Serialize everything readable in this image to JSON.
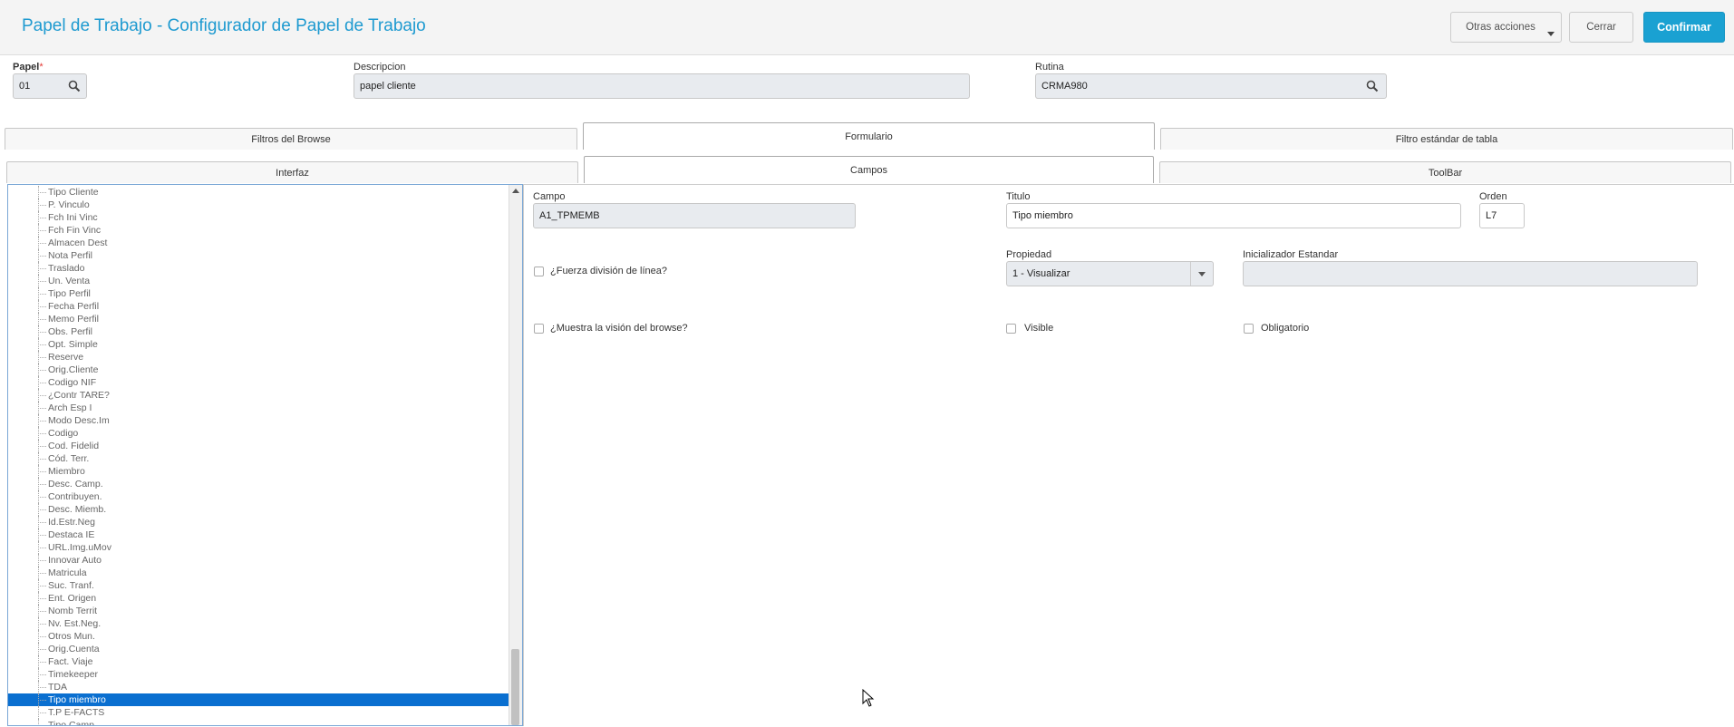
{
  "header": {
    "title": "Papel de Trabajo - Configurador de Papel de Trabajo",
    "buttons": {
      "other_actions": "Otras acciones",
      "close": "Cerrar",
      "confirm": "Confirmar"
    }
  },
  "form": {
    "papel": {
      "label": "Papel",
      "required_mark": "*",
      "value": "01"
    },
    "descripcion": {
      "label": "Descripcion",
      "value": "papel cliente"
    },
    "rutina": {
      "label": "Rutina",
      "value": "CRMA980"
    }
  },
  "tabs_row1": [
    "Filtros del Browse",
    "Formulario",
    "Filtro estándar de tabla"
  ],
  "tabs_row2": [
    "Interfaz",
    "Campos",
    "ToolBar"
  ],
  "active_tabs": [
    "Formulario",
    "Campos"
  ],
  "tree": {
    "items": [
      "Tipo Cliente",
      "P. Vinculo",
      "Fch Ini Vinc",
      "Fch Fin Vinc",
      "Almacen Dest",
      "Nota Perfil",
      "Traslado",
      "Un. Venta",
      "Tipo Perfil",
      "Fecha Perfil",
      "Memo Perfil",
      "Obs. Perfil",
      "Opt. Simple",
      "Reserve",
      "Orig.Cliente",
      "Codigo NIF",
      "¿Contr TARE?",
      "Arch Esp I",
      "Modo Desc.Im",
      "Codigo",
      "Cod. Fidelid",
      "Cód. Terr.",
      "Miembro",
      "Desc. Camp.",
      "Contribuyen.",
      "Desc. Miemb.",
      "Id.Estr.Neg",
      "Destaca IE",
      "URL.Img.uMov",
      "Innovar Auto",
      "Matricula",
      "Suc. Tranf.",
      "Ent. Origen",
      "Nomb Territ",
      "Nv. Est.Neg.",
      "Otros Mun.",
      "Orig.Cuenta",
      "Fact. Viaje",
      "Timekeeper",
      "TDA",
      "Tipo miembro",
      "T.P E-FACTS",
      "Tipo Camp"
    ],
    "selected": "Tipo miembro"
  },
  "detail": {
    "campo": {
      "label": "Campo",
      "value": "A1_TPMEMB"
    },
    "titulo": {
      "label": "Titulo",
      "value": "Tipo miembro"
    },
    "orden": {
      "label": "Orden",
      "value": "L7"
    },
    "fuerza": {
      "label": "¿Fuerza división de línea?",
      "checked": false
    },
    "propiedad": {
      "label": "Propiedad",
      "value": "1 - Visualizar"
    },
    "inicializador": {
      "label": "Inicializador Estandar",
      "value": ""
    },
    "muestra": {
      "label": "¿Muestra la visión del browse?",
      "checked": false
    },
    "visible": {
      "label": "Visible",
      "checked": false
    },
    "obligatorio": {
      "label": "Obligatorio",
      "checked": false
    }
  },
  "colors": {
    "accent": "#1e9ad0",
    "primary_button": "#1aa1d2",
    "selection": "#0a6fd0"
  }
}
